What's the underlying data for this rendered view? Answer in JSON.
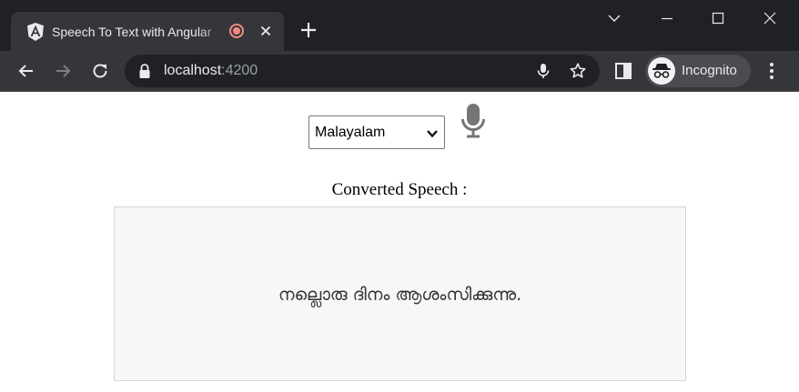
{
  "browser": {
    "tab": {
      "title": "Speech To Text with Angular",
      "favicon": "angular-logo-icon",
      "recording_indicator": "recording-icon",
      "close_icon": "close-icon"
    },
    "new_tab_icon": "plus-icon",
    "window_controls": [
      "chevron-down-icon",
      "minimize-icon",
      "maximize-icon",
      "close-icon"
    ],
    "toolbar": {
      "back_icon": "arrow-left-icon",
      "forward_icon": "arrow-right-icon",
      "reload_icon": "reload-icon",
      "address": {
        "host": "localhost",
        "port": ":4200",
        "lock_icon": "lock-icon",
        "mic_icon": "microphone-icon",
        "bookmark_icon": "star-icon"
      },
      "side_panel_icon": "side-panel-icon",
      "profile": {
        "label": "Incognito",
        "icon": "incognito-icon"
      },
      "menu_icon": "kebab-menu-icon"
    },
    "colors": {
      "titlebar": "#202124",
      "tab_active": "#35363a",
      "omnibox": "#202124",
      "record_accent": "#f28b82"
    }
  },
  "page": {
    "language_select": {
      "selected": "Malayalam"
    },
    "mic_button_icon": "microphone-icon",
    "converted_label": "Converted Speech :",
    "converted_text": "നല്ലൊരു ദിനം ആശംസിക്കുന്നു.",
    "colors": {
      "output_bg": "#f7f7f7",
      "mic": "#757575"
    }
  }
}
